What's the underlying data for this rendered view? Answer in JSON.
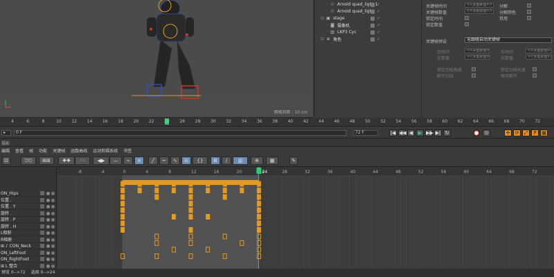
{
  "viewport": {
    "grid_spacing": "网格间距 : 10 cm"
  },
  "object_manager": {
    "objects": [
      {
        "name": "Arnold quad_light.1",
        "icon": "light-icon",
        "indent": 1
      },
      {
        "name": "Arnold quad_light",
        "icon": "light-icon",
        "indent": 1
      },
      {
        "name": "stage",
        "icon": "stage-icon",
        "indent": 0
      },
      {
        "name": "摄像机",
        "icon": "camera-icon",
        "indent": 1
      },
      {
        "name": "LKP3 Cyc",
        "icon": "cyc-icon",
        "indent": 1
      },
      {
        "name": "角色",
        "icon": "null-icon",
        "indent": 0
      }
    ]
  },
  "attributes": {
    "rows": [
      {
        "label": "关键帧时间",
        "field": "<<多重数值>>",
        "right_label": "分解"
      },
      {
        "label": "关键帧数值",
        "field": "<<多重数值>>",
        "right_label": "分解颜色"
      },
      {
        "label": "锁定时间",
        "right_label": "禁用"
      },
      {
        "label": "锁定数值"
      }
    ],
    "preset_label": "关键帧预设",
    "preset_value": "无跟随自动关键帧",
    "dim_rows": [
      {
        "label": "左时间",
        "field": "<<多重数值>>",
        "right_label": "右时间",
        "right_field": "<<多重数值>>"
      },
      {
        "label": "左数值",
        "field": "<<多重数值>>",
        "right_label": "右数值",
        "right_field": "<<多重数值>>"
      },
      {
        "label": "锁定切线角度",
        "right_label": "锁定切线长度"
      },
      {
        "label": "断开切线",
        "right_label": "保持断开"
      }
    ]
  },
  "ruler": {
    "ticks": [
      "4",
      "6",
      "8",
      "10",
      "12",
      "14",
      "16",
      "18",
      "20",
      "22",
      "24",
      "26",
      "28",
      "30",
      "32",
      "34",
      "36",
      "38",
      "40",
      "42",
      "44",
      "46",
      "48",
      "50",
      "52",
      "54",
      "56",
      "58",
      "60",
      "62",
      "64",
      "66",
      "68",
      "70",
      "72"
    ],
    "current": "24"
  },
  "transport": {
    "start_frame": "0 F",
    "end_frame": "72 F",
    "fps": "72 F",
    "buttons": [
      "|◀",
      "◀◀",
      "◀",
      "▶",
      "▶▶",
      "▶|",
      "↻"
    ]
  },
  "timeline": {
    "header_label": "摄影",
    "menu": [
      "编辑",
      "查看",
      "帧",
      "功能",
      "关键帧",
      "函数曲线",
      "运动剪辑系统",
      "书签"
    ],
    "frame_labels": [
      "-8",
      "-4",
      "0",
      "4",
      "8",
      "12",
      "16",
      "20",
      "24",
      "28",
      "32",
      "36",
      "40",
      "44",
      "48",
      "52",
      "56",
      "60",
      "64",
      "68",
      "72"
    ],
    "current_frame": "24",
    "tracks": [
      {
        "name": "ON_Hips"
      },
      {
        "name": "位置 ."
      },
      {
        "name": "位置 . Y"
      },
      {
        "name": "旋转 ."
      },
      {
        "name": "旋转 . P"
      },
      {
        "name": "旋转 . H"
      },
      {
        "name": "L相册"
      },
      {
        "name": "R相册"
      },
      {
        "name": "⊞ ♪ CON_Neck"
      },
      {
        "name": "ON_LeftFoot"
      },
      {
        "name": "ON_RightFoot"
      },
      {
        "name": "⊞ L 整合"
      }
    ]
  },
  "status": {
    "preview": "预览 0-->72",
    "selection": "选择 0-->24"
  },
  "colors": {
    "accent": "#e59a1f",
    "cursor": "#2ecc71"
  }
}
